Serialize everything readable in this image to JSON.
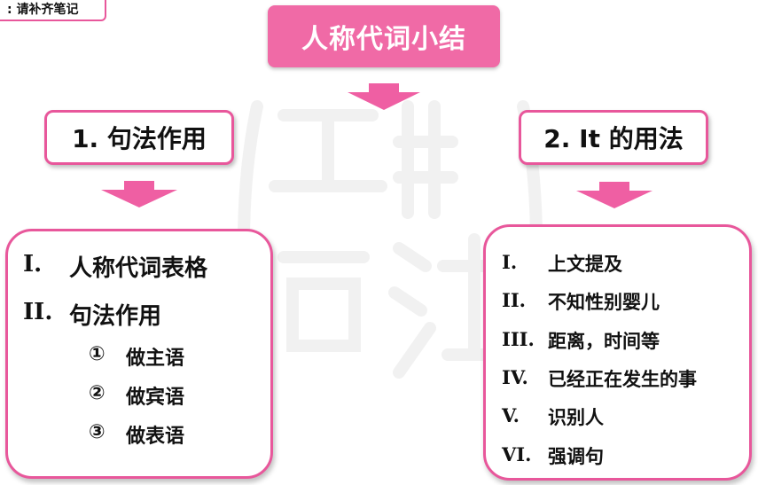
{
  "note_tag": ": 请补齐笔记",
  "title": "人称代词小结",
  "left": {
    "heading": "1. 句法作用",
    "items": [
      {
        "num": "I.",
        "text": "人称代词表格"
      },
      {
        "num": "II.",
        "text": "句法作用"
      }
    ],
    "subitems": [
      {
        "num": "①",
        "text": "做主语"
      },
      {
        "num": "②",
        "text": "做宾语"
      },
      {
        "num": "③",
        "text": "做表语"
      }
    ]
  },
  "right": {
    "heading": "2. It 的用法",
    "items": [
      {
        "num": "I.",
        "text": "上文提及"
      },
      {
        "num": "II.",
        "text": "不知性别婴儿"
      },
      {
        "num": "III.",
        "text": "距离，时间等"
      },
      {
        "num": "IV.",
        "text": "已经正在发生的事"
      },
      {
        "num": "V.",
        "text": "识别人"
      },
      {
        "num": "VI.",
        "text": "强调句"
      }
    ]
  },
  "colors": {
    "pink": "#e8579b",
    "title_fill": "#f06aa6"
  }
}
